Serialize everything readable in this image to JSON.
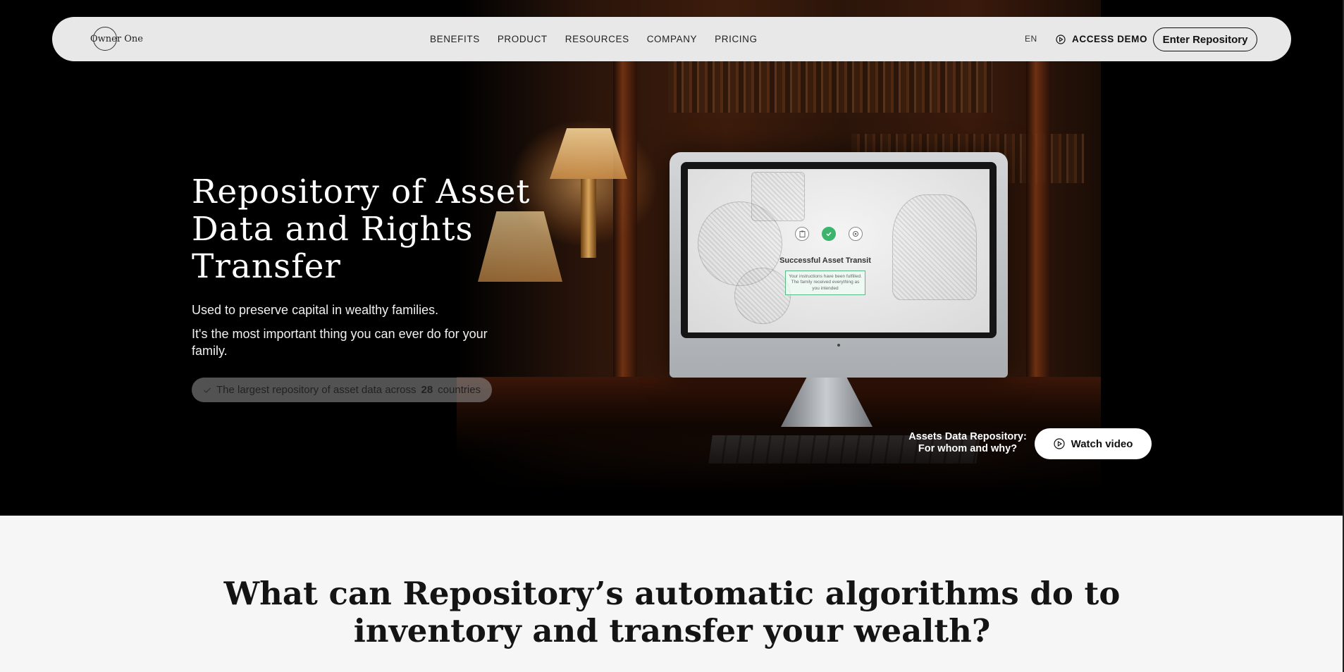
{
  "nav": {
    "logo_text": "Owner One",
    "links": [
      "BENEFITS",
      "PRODUCT",
      "RESOURCES",
      "COMPANY",
      "PRICING"
    ],
    "language": "EN",
    "access_demo_label": "ACCESS DEMO",
    "enter_repository_label": "Enter Repository"
  },
  "hero": {
    "title": "Repository of Asset Data and Rights Transfer",
    "subtitle_1": "Used to preserve capital in wealthy families.",
    "subtitle_2": "It's the most important thing you can ever do for your family.",
    "stat": {
      "prefix": "The largest repository of asset data across",
      "number": "28",
      "suffix": "countries"
    },
    "video_caption_line1": "Assets Data Repository:",
    "video_caption_line2": "For whom and why?",
    "watch_video_label": "Watch video",
    "screen": {
      "title": "Successful Asset Transit",
      "note": "Your instructions have been fulfilled. The family received everything as you intended"
    }
  },
  "section2": {
    "title": "What can Repository’s automatic algorithms do to inventory and transfer your wealth?"
  },
  "colors": {
    "nav_bg": "#e8e8e8",
    "hero_bg": "#000000",
    "section_bg": "#f6f6f6",
    "success_green": "#3bb56b"
  },
  "icons": [
    "check-icon",
    "play-circle-icon",
    "clipboard-icon",
    "check-circle-icon",
    "target-icon"
  ]
}
